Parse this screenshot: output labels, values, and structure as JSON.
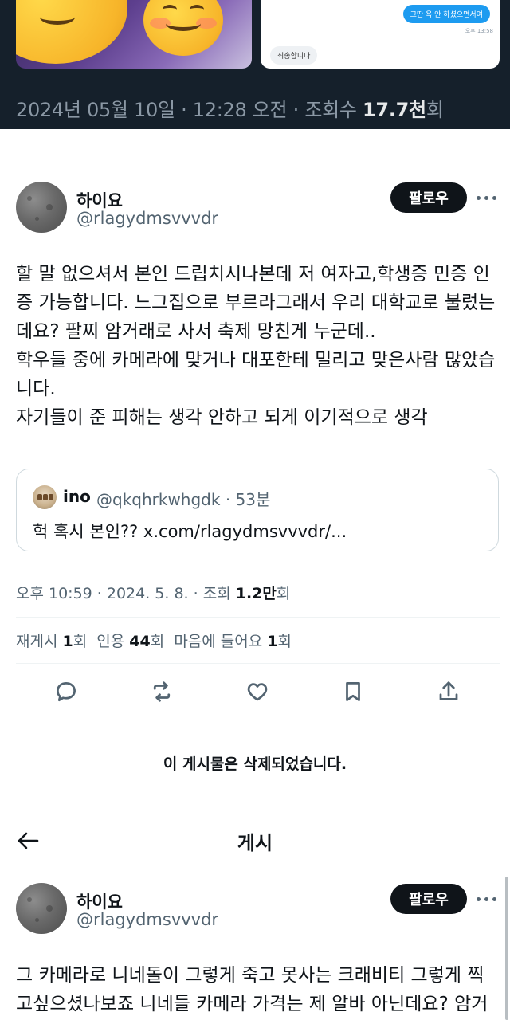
{
  "top_banner": {
    "dm_outgoing": "그딴 욕 안 하셨으면서여",
    "dm_outgoing_time": "오후 13:58",
    "dm_incoming": "죄송합니다",
    "date": "2024년 05월 10일",
    "time": "12:28 오전",
    "views_label": "조회수",
    "views_value": "17.7천",
    "views_suffix": "회"
  },
  "tweet": {
    "display_name": "하이요",
    "handle": "@rlagydmsvvvdr",
    "follow_label": "팔로우",
    "body_lines": [
      "할 말 없으셔서 본인 드립치시나본데 저 여자고,학생증 민증 인",
      "증 가능합니다. 느그집으로 부르라그래서 우리 대학교로 불렀는",
      "데요? 팔찌 암거래로 사서 축제 망친게 누군데..",
      "학우들 중에 카메라에 맞거나 대포한테 밀리고 맞은사람 많았습",
      "니다.",
      "자기들이 준 피해는 생각 안하고 되게 이기적으로 생각"
    ],
    "quote": {
      "name": "ino",
      "handle_time": "@qkqhrkwhgdk · 53분",
      "text": "헉 혹시 본인?? x.com/rlagydmsvvvdr/..."
    },
    "timestamp": "오후 10:59 · 2024. 5. 8. · 조회 ",
    "views_value": "1.2만",
    "views_suffix": "회",
    "stats": {
      "reposts_label": "재게시 ",
      "reposts_value": "1",
      "reposts_suffix": "회",
      "quotes_label": "인용 ",
      "quotes_value": "44",
      "quotes_suffix": "회",
      "likes_label": "마음에 들어요 ",
      "likes_value": "1",
      "likes_suffix": "회"
    },
    "actions": [
      "reply-icon",
      "repost-icon",
      "like-icon",
      "bookmark-icon",
      "share-icon"
    ]
  },
  "deleted_notice": "이 게시물은 삭제되었습니다.",
  "page_header": {
    "title": "게시"
  },
  "tweet2": {
    "display_name": "하이요",
    "handle": "@rlagydmsvvvdr",
    "follow_label": "팔로우",
    "body_lines": [
      "그 카메라로 니네돌이 그렇게 죽고 못사는 크래비티 그렇게 찍",
      "고싶으셨나보죠 니네들 카메라 가격는 제 알바 아닌데요? 암거"
    ]
  }
}
